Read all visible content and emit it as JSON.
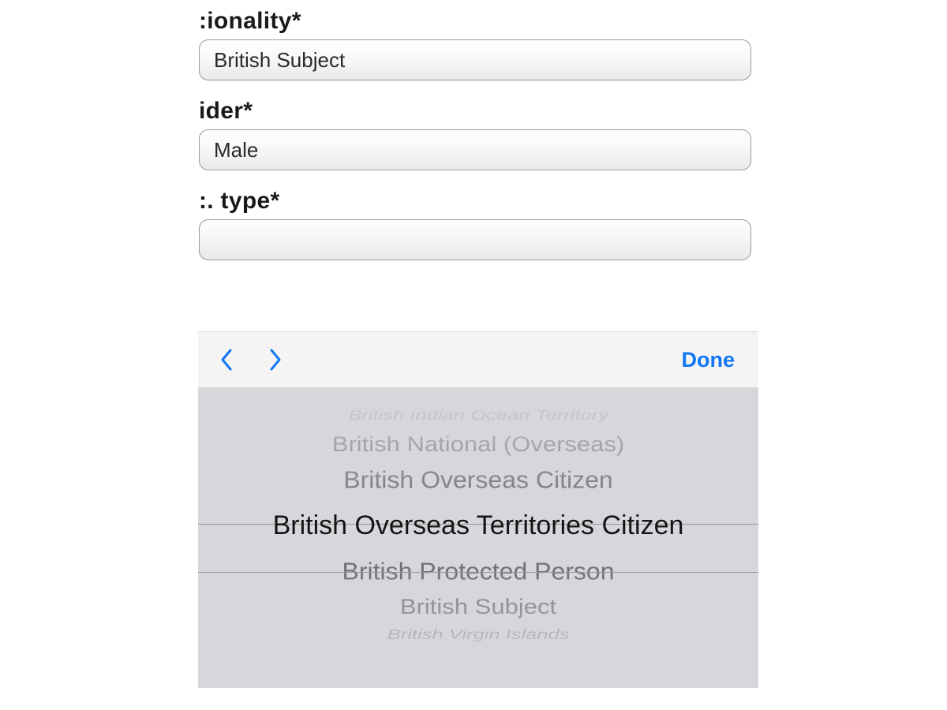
{
  "form": {
    "fields": [
      {
        "label": ":ionality*",
        "value": "British Subject"
      },
      {
        "label": "ider*",
        "value": "Male"
      },
      {
        "label": ":. type*",
        "value": ""
      }
    ]
  },
  "picker": {
    "done_label": "Done",
    "options": [
      "British Indian Ocean Territory",
      "British National (Overseas)",
      "British Overseas Citizen",
      "British Overseas Territories Citizen",
      "British Protected Person",
      "British Subject",
      "British Virgin Islands"
    ],
    "selected_index": 3
  }
}
